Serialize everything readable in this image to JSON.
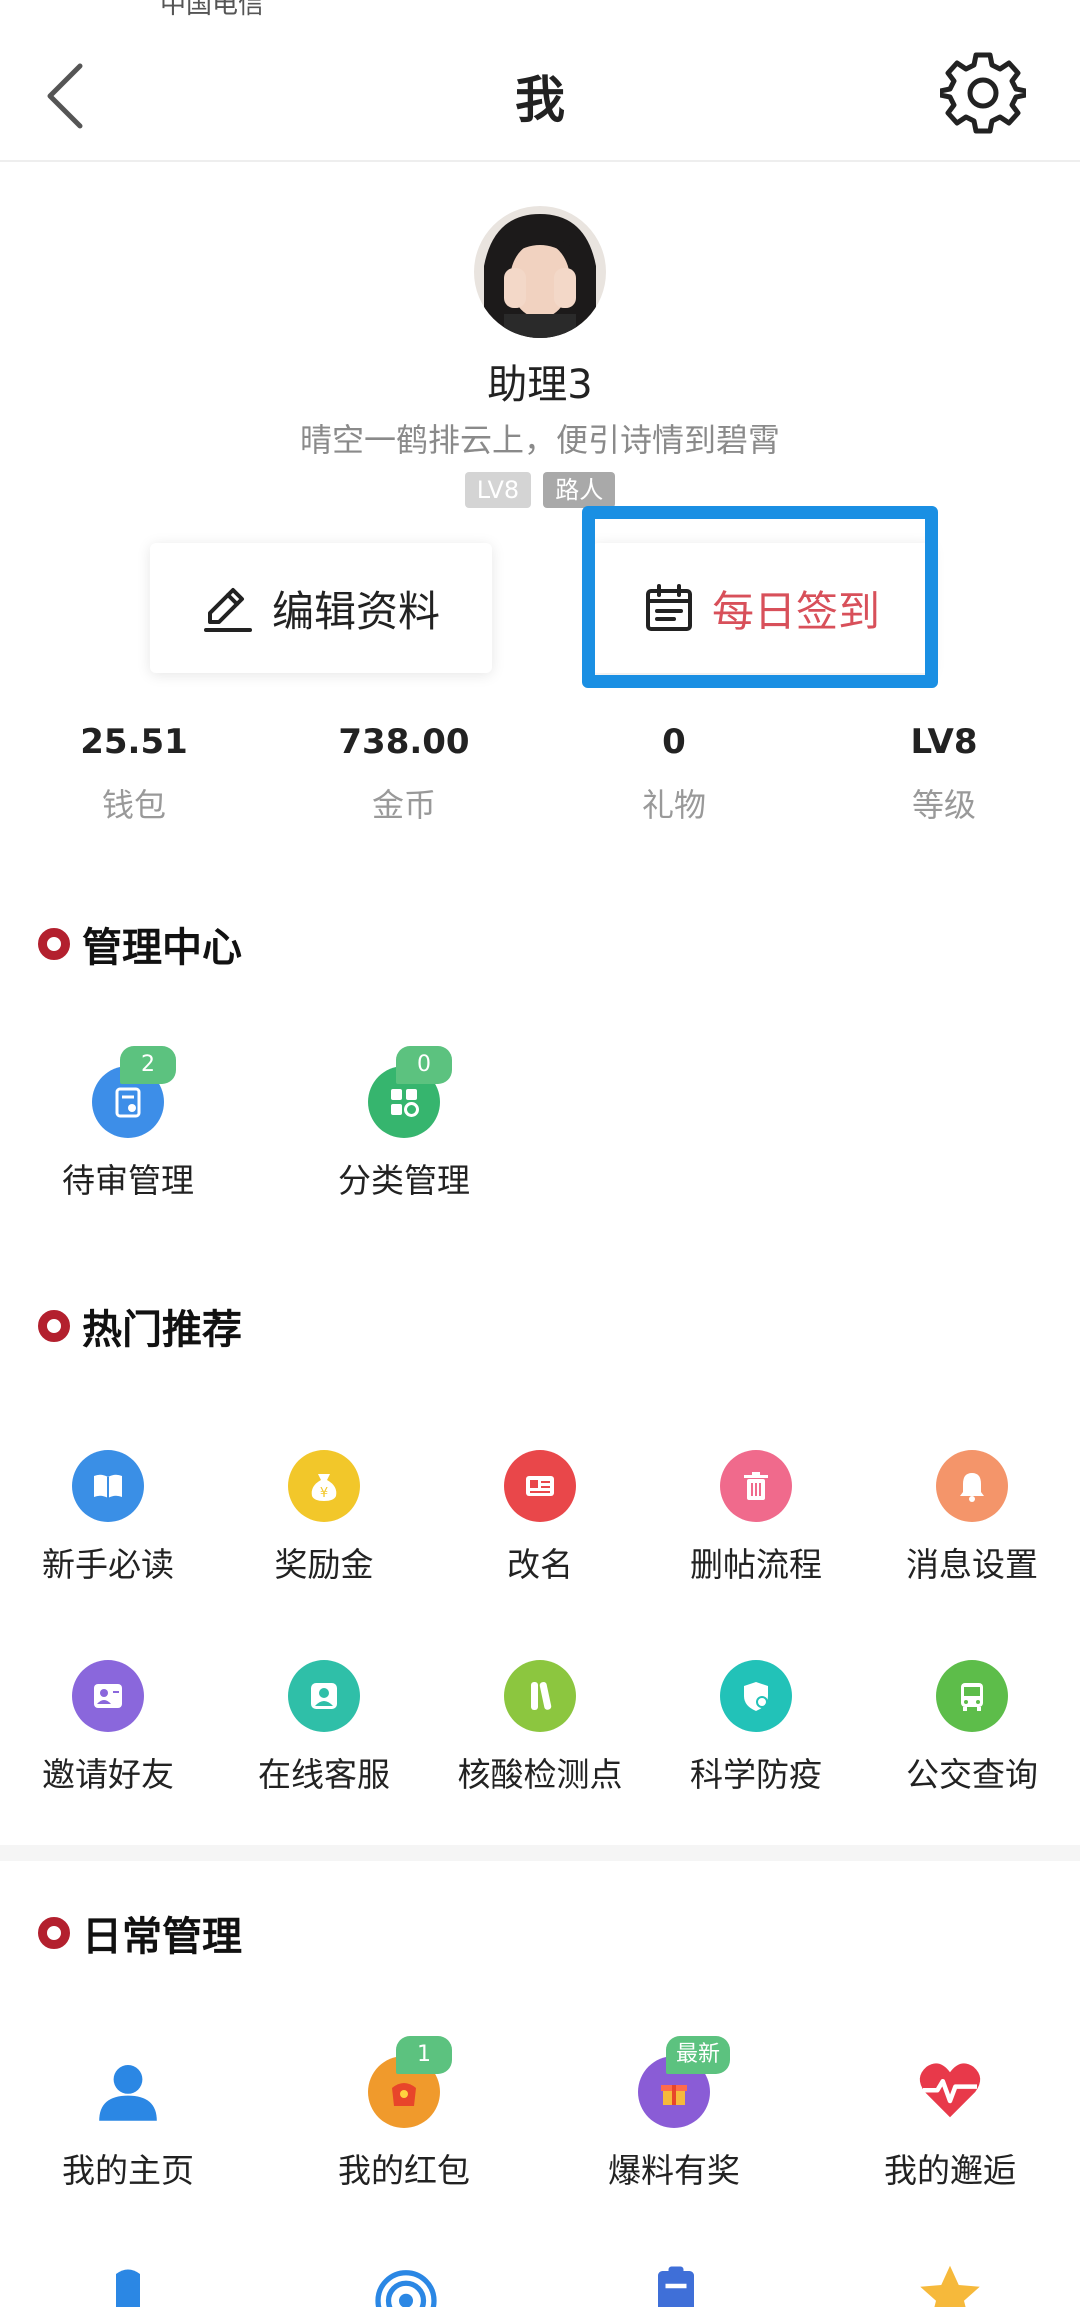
{
  "status_bar": {
    "text": "中国电信"
  },
  "header": {
    "title": "我"
  },
  "profile": {
    "name": "助理3",
    "motto": "晴空一鹤排云上，便引诗情到碧霄",
    "tags": [
      "LV8",
      "路人"
    ]
  },
  "actions": {
    "edit_label": "编辑资料",
    "signin_label": "每日签到"
  },
  "stats": [
    {
      "value": "25.51",
      "label": "钱包"
    },
    {
      "value": "738.00",
      "label": "金币"
    },
    {
      "value": "0",
      "label": "礼物"
    },
    {
      "value": "LV8",
      "label": "等级"
    }
  ],
  "management": {
    "title": "管理中心",
    "items": [
      {
        "label": "待审管理",
        "badge": "2",
        "icon": "review-icon",
        "color": "#3d8ee8"
      },
      {
        "label": "分类管理",
        "badge": "0",
        "icon": "category-icon",
        "color": "#36b56e"
      }
    ]
  },
  "hot": {
    "title": "热门推荐",
    "items": [
      {
        "label": "新手必读",
        "icon": "book-icon",
        "color": "#3a8fe6"
      },
      {
        "label": "奖励金",
        "icon": "money-bag-icon",
        "color": "#f2c72a"
      },
      {
        "label": "改名",
        "icon": "id-card-icon",
        "color": "#e9474a"
      },
      {
        "label": "删帖流程",
        "icon": "trash-icon",
        "color": "#f06a8c"
      },
      {
        "label": "消息设置",
        "icon": "bell-icon",
        "color": "#f4956a"
      },
      {
        "label": "邀请好友",
        "icon": "invite-icon",
        "color": "#8a67dc"
      },
      {
        "label": "在线客服",
        "icon": "support-icon",
        "color": "#2fbfa8"
      },
      {
        "label": "核酸检测点",
        "icon": "test-tube-icon",
        "color": "#8cc63f"
      },
      {
        "label": "科学防疫",
        "icon": "shield-icon",
        "color": "#22c2b8"
      },
      {
        "label": "公交查询",
        "icon": "bus-icon",
        "color": "#5dbd4a"
      }
    ]
  },
  "daily": {
    "title": "日常管理",
    "items": [
      {
        "label": "我的主页",
        "icon": "user-icon",
        "color": "#2b87e4",
        "badge": ""
      },
      {
        "label": "我的红包",
        "icon": "red-envelope-icon",
        "color": "#f09a2c",
        "badge": "1"
      },
      {
        "label": "爆料有奖",
        "icon": "gift-icon",
        "color": "#8a5cd6",
        "badge": "最新"
      },
      {
        "label": "我的邂逅",
        "icon": "heartbeat-icon",
        "color": "#e8394a",
        "badge": ""
      }
    ]
  }
}
